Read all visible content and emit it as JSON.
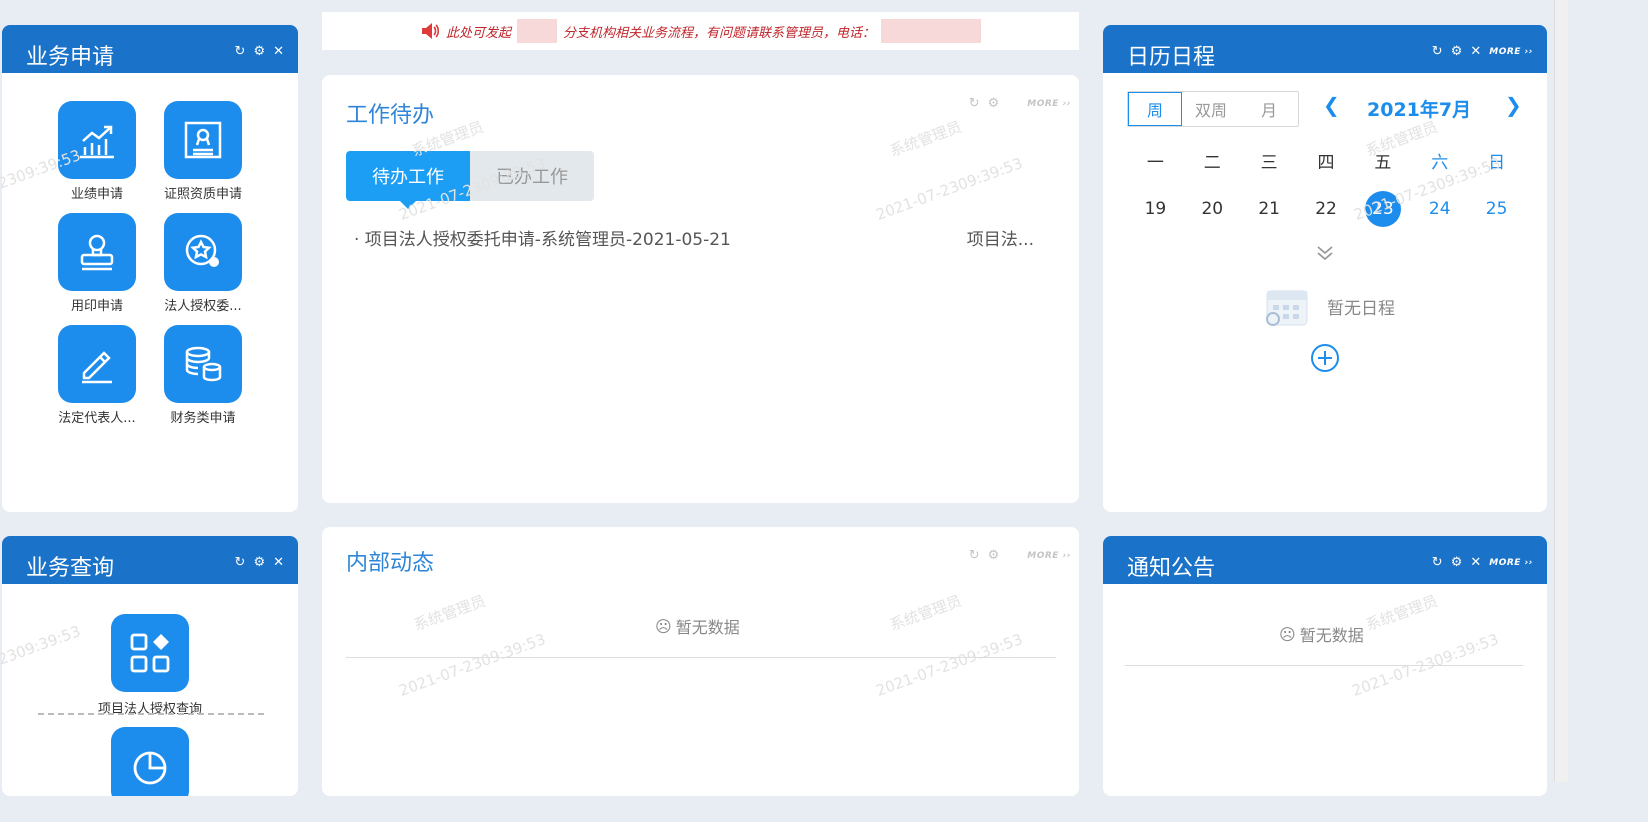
{
  "notice": {
    "text_before": "此处可发起",
    "text_after": "分支机构相关业务流程，有问题请联系管理员，电话："
  },
  "business_apply": {
    "title": "业务申请",
    "apps": [
      {
        "label": "业绩申请",
        "icon": "chart-growth-icon"
      },
      {
        "label": "证照资质申请",
        "icon": "certificate-icon"
      },
      {
        "label": "用印申请",
        "icon": "stamp-icon"
      },
      {
        "label": "法人授权委...",
        "icon": "authorization-icon"
      },
      {
        "label": "法定代表人...",
        "icon": "pen-icon"
      },
      {
        "label": "财务类申请",
        "icon": "coins-icon"
      }
    ]
  },
  "work_todo": {
    "title": "工作待办",
    "more": "MORE",
    "tabs": [
      "待办工作",
      "已办工作"
    ],
    "items": [
      {
        "text": "· 项目法人授权委托申请-系统管理员-2021-05-21",
        "type": "项目法..."
      }
    ]
  },
  "calendar": {
    "title": "日历日程",
    "more": "MORE",
    "modes": [
      "周",
      "双周",
      "月"
    ],
    "month_label": "2021年7月",
    "weekdays": [
      "一",
      "二",
      "三",
      "四",
      "五",
      "六",
      "日"
    ],
    "days": [
      "19",
      "20",
      "21",
      "22",
      "23",
      "24",
      "25"
    ],
    "today": "23",
    "empty_text": "暂无日程"
  },
  "business_query": {
    "title": "业务查询",
    "apps": [
      {
        "label": "项目法人授权查询",
        "icon": "grid-apps-icon"
      },
      {
        "label": "",
        "icon": "pie-chart-icon"
      }
    ]
  },
  "internal_news": {
    "title": "内部动态",
    "more": "MORE",
    "empty_text": "暂无数据"
  },
  "announcements": {
    "title": "通知公告",
    "more": "MORE",
    "empty_text": "暂无数据"
  },
  "watermark": {
    "user": "系统管理员",
    "time": "2021-07-2309:39:53"
  },
  "colors": {
    "header_blue": "#1a73c9",
    "accent_blue": "#1d8ded",
    "notice_red": "#c0262b"
  }
}
